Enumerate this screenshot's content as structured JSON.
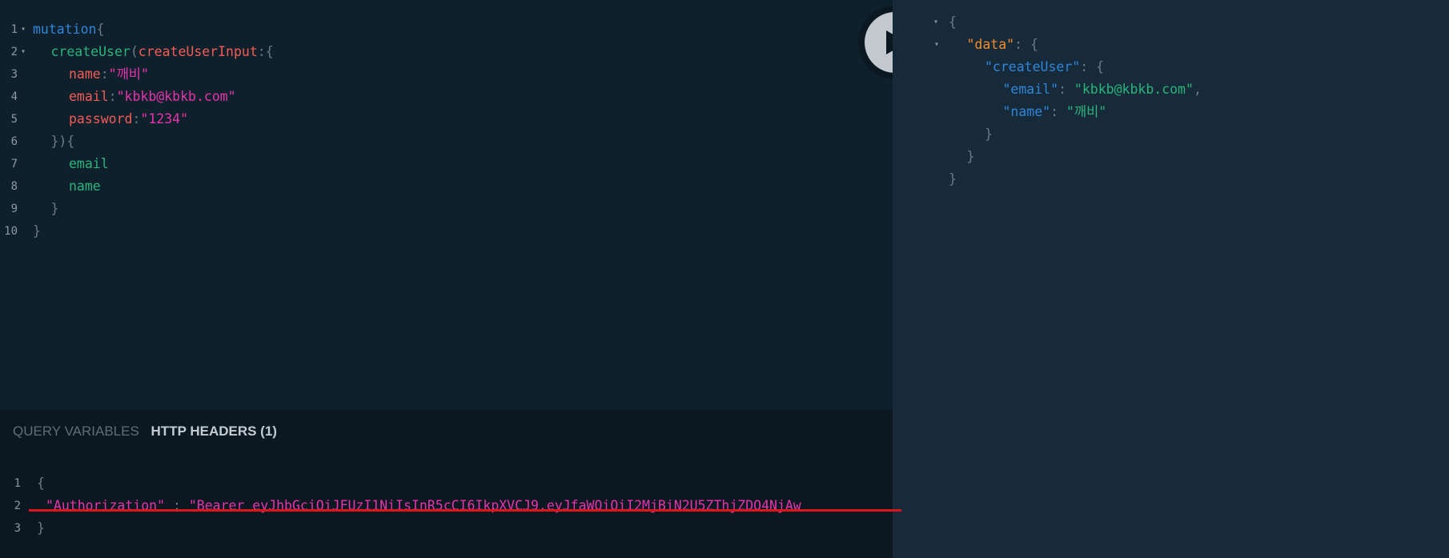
{
  "query_editor": {
    "lines": [
      {
        "n": "1",
        "segments": [
          {
            "t": "mutation",
            "c": "kw"
          },
          {
            "t": "{",
            "c": "punc"
          }
        ]
      },
      {
        "n": "2",
        "segments": [
          {
            "t": "createUser",
            "c": "fn"
          },
          {
            "t": "(",
            "c": "punc"
          },
          {
            "t": "createUserInput",
            "c": "arg"
          },
          {
            "t": ":{",
            "c": "punc"
          }
        ]
      },
      {
        "n": "3",
        "segments": [
          {
            "t": "name",
            "c": "arg"
          },
          {
            "t": ":",
            "c": "punc"
          },
          {
            "t": "\"깨비\"",
            "c": "str"
          }
        ]
      },
      {
        "n": "4",
        "segments": [
          {
            "t": "email",
            "c": "arg"
          },
          {
            "t": ":",
            "c": "punc"
          },
          {
            "t": "\"kbkb@kbkb.com\"",
            "c": "str"
          }
        ]
      },
      {
        "n": "5",
        "segments": [
          {
            "t": "password",
            "c": "arg"
          },
          {
            "t": ":",
            "c": "punc"
          },
          {
            "t": "\"1234\"",
            "c": "str"
          }
        ]
      },
      {
        "n": "6",
        "segments": [
          {
            "t": "}){",
            "c": "punc"
          }
        ]
      },
      {
        "n": "7",
        "segments": [
          {
            "t": "email",
            "c": "fn"
          }
        ]
      },
      {
        "n": "8",
        "segments": [
          {
            "t": "name",
            "c": "fn"
          }
        ]
      },
      {
        "n": "9",
        "segments": [
          {
            "t": "}",
            "c": "punc"
          }
        ]
      },
      {
        "n": "10",
        "segments": [
          {
            "t": "}",
            "c": "punc"
          }
        ]
      }
    ]
  },
  "run_button_icon": "play-icon",
  "result": {
    "lines": [
      {
        "segments": [
          {
            "t": "{",
            "c": "rpunc"
          }
        ]
      },
      {
        "segments": [
          {
            "t": "\"data\"",
            "c": "rkey-orange"
          },
          {
            "t": ": {",
            "c": "rpunc"
          }
        ]
      },
      {
        "segments": [
          {
            "t": "\"createUser\"",
            "c": "rkey"
          },
          {
            "t": ": {",
            "c": "rpunc"
          }
        ]
      },
      {
        "segments": [
          {
            "t": "\"email\"",
            "c": "rkey"
          },
          {
            "t": ": ",
            "c": "rpunc"
          },
          {
            "t": "\"kbkb@kbkb.com\"",
            "c": "rstr"
          },
          {
            "t": ",",
            "c": "rpunc"
          }
        ]
      },
      {
        "segments": [
          {
            "t": "\"name\"",
            "c": "rkey"
          },
          {
            "t": ": ",
            "c": "rpunc"
          },
          {
            "t": "\"깨비\"",
            "c": "rstr"
          }
        ]
      },
      {
        "segments": [
          {
            "t": "}",
            "c": "rpunc"
          }
        ]
      },
      {
        "segments": [
          {
            "t": "}",
            "c": "rpunc"
          }
        ]
      },
      {
        "segments": [
          {
            "t": "}",
            "c": "rpunc"
          }
        ]
      }
    ]
  },
  "bottom_panel": {
    "tabs": {
      "query_variables": "QUERY VARIABLES",
      "http_headers": "HTTP HEADERS (1)"
    },
    "lines": [
      {
        "n": "1",
        "segments": [
          {
            "t": "{",
            "c": "punc"
          }
        ]
      },
      {
        "n": "2",
        "segments": [
          {
            "t": "\"Authorization\"",
            "c": "str"
          },
          {
            "t": " : ",
            "c": "punc"
          },
          {
            "t": "\"Bearer eyJhbGciOiJFUzI1NiIsInR5cCI6IkpXVCJ9.eyJfaWQiOiI2MjBiN2U5ZThjZDQ4NjAw",
            "c": "str"
          }
        ]
      },
      {
        "n": "3",
        "segments": [
          {
            "t": "}",
            "c": "punc"
          }
        ]
      }
    ]
  },
  "colors": {
    "keyword": "#2f86d8",
    "field": "#29b47a",
    "argument": "#f25c54",
    "string": "#e535ab",
    "highlight_underline": "#e0141b"
  }
}
